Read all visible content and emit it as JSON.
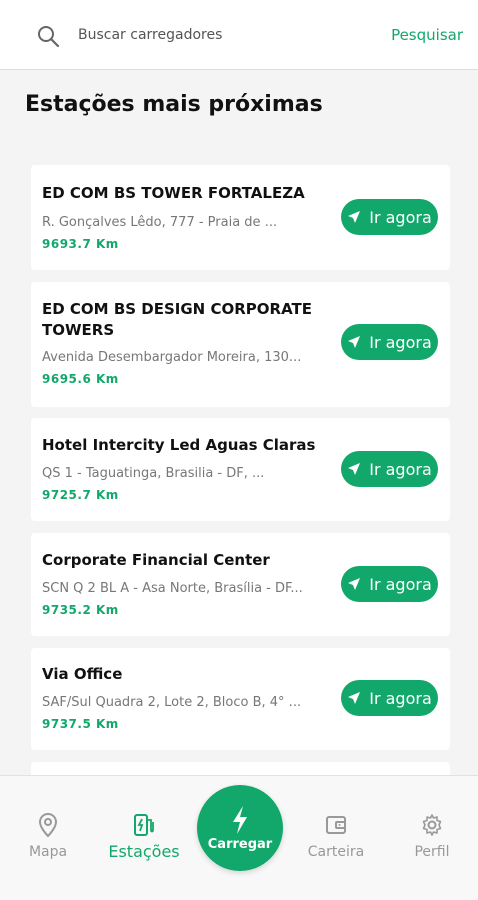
{
  "search": {
    "placeholder": "Buscar carregadores",
    "button_label": "Pesquisar"
  },
  "section_title": "Estações mais próximas",
  "stations": [
    {
      "name": "ED COM BS TOWER FORTALEZA",
      "address": "R. Gonçalves Lêdo, 777 - Praia de ...",
      "distance": "9693.7 Km",
      "button_label": "Ir agora"
    },
    {
      "name": "ED COM BS DESIGN CORPORATE TOWERS",
      "address": "Avenida Desembargador Moreira, 130...",
      "distance": "9695.6 Km",
      "button_label": "Ir agora"
    },
    {
      "name": "Hotel Intercity Led Aguas Claras",
      "address": "QS 1 - Taguatinga, Brasilia - DF, ...",
      "distance": "9725.7 Km",
      "button_label": "Ir agora"
    },
    {
      "name": "Corporate Financial Center",
      "address": "SCN Q 2 BL A - Asa Norte, Brasília - DF...",
      "distance": "9735.2 Km",
      "button_label": "Ir agora"
    },
    {
      "name": "Via Office",
      "address": "SAF/Sul Quadra 2, Lote 2, Bloco B, 4° ...",
      "distance": "9737.5 Km",
      "button_label": "Ir agora"
    }
  ],
  "nav": {
    "items": [
      {
        "label": "Mapa",
        "icon": "map-pin-icon",
        "active": false
      },
      {
        "label": "Estações",
        "icon": "charging-station-icon",
        "active": true
      },
      {
        "label": "Carteira",
        "icon": "wallet-icon",
        "active": false
      },
      {
        "label": "Perfil",
        "icon": "gear-icon",
        "active": false
      }
    ],
    "fab_label": "Carregar"
  },
  "colors": {
    "accent": "#12a86b",
    "muted": "#999999"
  }
}
